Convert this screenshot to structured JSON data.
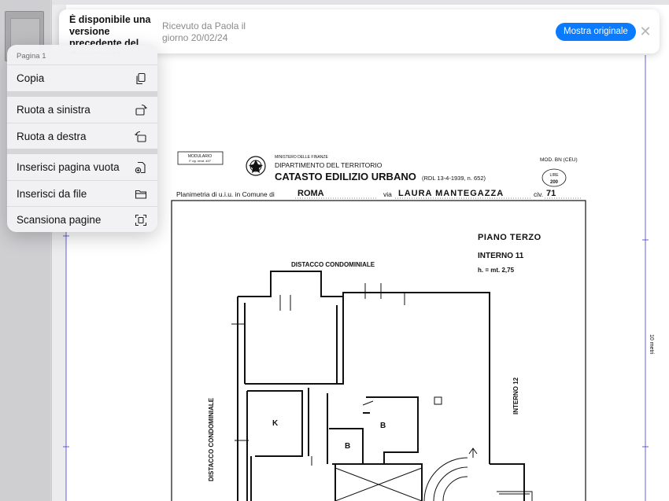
{
  "banner": {
    "title": "È disponibile una versione precedente del documento",
    "subtitle": "Ricevuto da Paola il giorno 20/02/24",
    "button_label": "Mostra originale",
    "close_glyph": "✕",
    "accent_color": "#0a7aff"
  },
  "menu": {
    "header": "Pagina 1",
    "groups": [
      [
        {
          "label": "Copia",
          "icon": "copy-icon"
        }
      ],
      [
        {
          "label": "Ruota a sinistra",
          "icon": "rotate-left-icon"
        },
        {
          "label": "Ruota a destra",
          "icon": "rotate-right-icon"
        }
      ],
      [
        {
          "label": "Inserisci pagina vuota",
          "icon": "insert-blank-page-icon"
        },
        {
          "label": "Inserisci da file",
          "icon": "folder-icon"
        },
        {
          "label": "Scansiona pagine",
          "icon": "scan-icon"
        }
      ]
    ]
  },
  "document": {
    "modulario": "MODULARIO",
    "modulario_sub": "F. rig. rend. 497",
    "ministry": "MINISTERO DELLE FINANZE",
    "department": "DIPARTIMENTO DEL TERRITORIO",
    "catasto": "CATASTO EDILIZIO URBANO",
    "law_ref": "(RDL 13-4-1939, n. 652)",
    "mod": "MOD. BN (CEU)",
    "stamp_top": "LIRE",
    "stamp_bottom": "200",
    "planimetria_label": "Planimetria di u.i.u. in Comune di",
    "comune": "ROMA",
    "via_label": "via",
    "via": "LAURA MANTEGAZZA",
    "civ_label": "civ.",
    "civ": "71",
    "piano": "PIANO TERZO",
    "interno": "INTERNO 11",
    "altezza": "h. = mt. 2,75",
    "distacco_top": "DISTACCO CONDOMINIALE",
    "distacco_left": "DISTACCO CONDOMINIALE",
    "interno_12": "INTERNO 12",
    "room_k": "K",
    "room_b1": "B",
    "room_b2": "B",
    "scale_label": "10 metri"
  }
}
